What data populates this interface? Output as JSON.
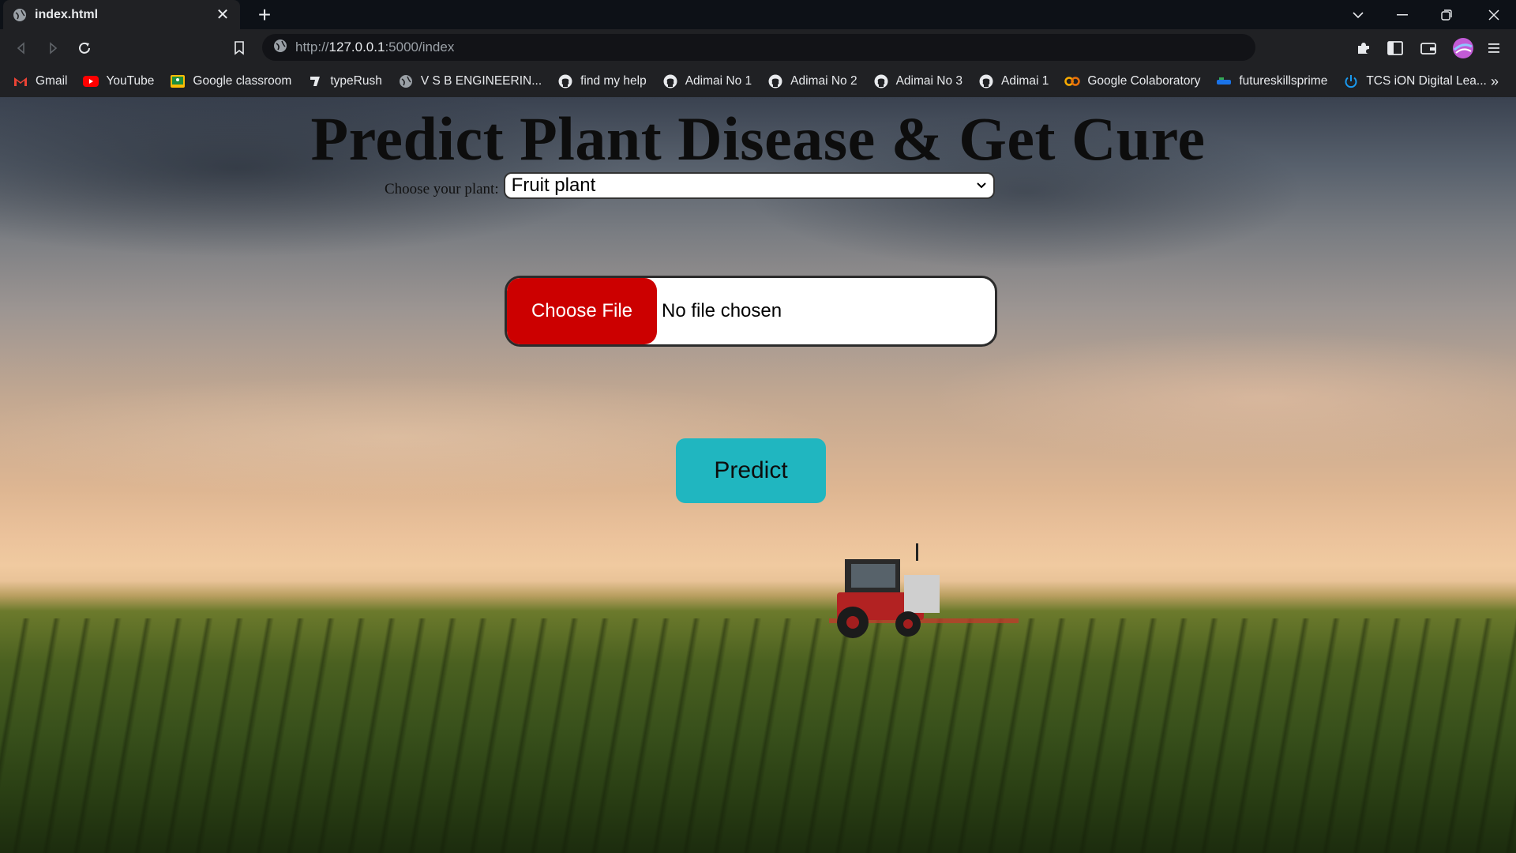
{
  "browser": {
    "tab": {
      "title": "index.html",
      "close_glyph": "✕"
    },
    "new_tab_glyph": "+",
    "address": {
      "scheme": "http://",
      "host": "127.0.0.1",
      "rest": ":5000/index"
    },
    "bookmarks": [
      {
        "label": "Gmail",
        "icon": "gmail-icon"
      },
      {
        "label": "YouTube",
        "icon": "youtube-icon"
      },
      {
        "label": "Google classroom",
        "icon": "classroom-icon"
      },
      {
        "label": "typeRush",
        "icon": "typerush-icon"
      },
      {
        "label": "V S B ENGINEERIN...",
        "icon": "globe-icon"
      },
      {
        "label": "find my help",
        "icon": "github-icon"
      },
      {
        "label": "Adimai No 1",
        "icon": "github-icon"
      },
      {
        "label": "Adimai No 2",
        "icon": "github-icon"
      },
      {
        "label": "Adimai No 3",
        "icon": "github-icon"
      },
      {
        "label": "Adimai 1",
        "icon": "github-icon"
      },
      {
        "label": "Google Colaboratory",
        "icon": "colab-icon"
      },
      {
        "label": "futureskillsprime",
        "icon": "futureskills-icon"
      },
      {
        "label": "TCS iON Digital Lea...",
        "icon": "power-icon"
      }
    ],
    "bookmarks_more": "»"
  },
  "page": {
    "heading": "Predict Plant Disease & Get Cure",
    "plant_label": "Choose your plant:",
    "plant_selected": "Fruit plant",
    "file_button": "Choose File",
    "file_status": "No file chosen",
    "predict_button": "Predict"
  },
  "colors": {
    "choose_file_bg": "#cc0000",
    "predict_bg": "#20b6c0"
  }
}
